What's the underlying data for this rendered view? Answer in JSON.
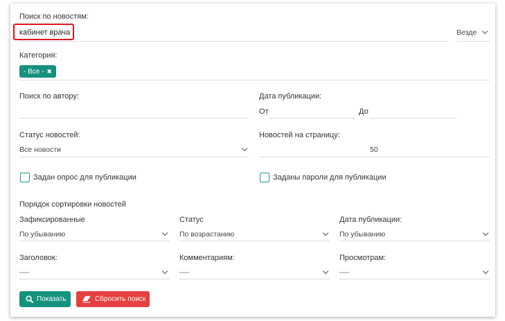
{
  "search": {
    "label": "Поиск по новостям:",
    "value": "кабинет врача",
    "scope": "Везде"
  },
  "category": {
    "label": "Категория:",
    "tag": "- Все -",
    "tag_remove": "✖"
  },
  "author": {
    "label": "Поиск по автору:",
    "value": ""
  },
  "pubdate": {
    "label": "Дата публикации:",
    "from_label": "От",
    "to_label": "До"
  },
  "status": {
    "label": "Статус новостей:",
    "value": "Все новости"
  },
  "per_page": {
    "label": "Новостей на страницу:",
    "value": "50"
  },
  "options": {
    "poll": "Задан опрос для публикации",
    "passwords": "Заданы пароли для публикации"
  },
  "sorting": {
    "title": "Порядок сортировки новостей",
    "fields": [
      {
        "label": "Зафиксированные",
        "value": "По убыванию"
      },
      {
        "label": "Статус",
        "value": "По возрастанию"
      },
      {
        "label": "Дата публикации:",
        "value": "По убыванию"
      },
      {
        "label": "Заголовок:",
        "value": "----"
      },
      {
        "label": "Комментариям:",
        "value": "----"
      },
      {
        "label": "Просмотрам:",
        "value": "----"
      }
    ]
  },
  "buttons": {
    "show": "Показать",
    "reset": "Сбросить поиск"
  },
  "colors": {
    "accent": "#18907e",
    "danger": "#e64040",
    "highlight": "#e0161b"
  }
}
